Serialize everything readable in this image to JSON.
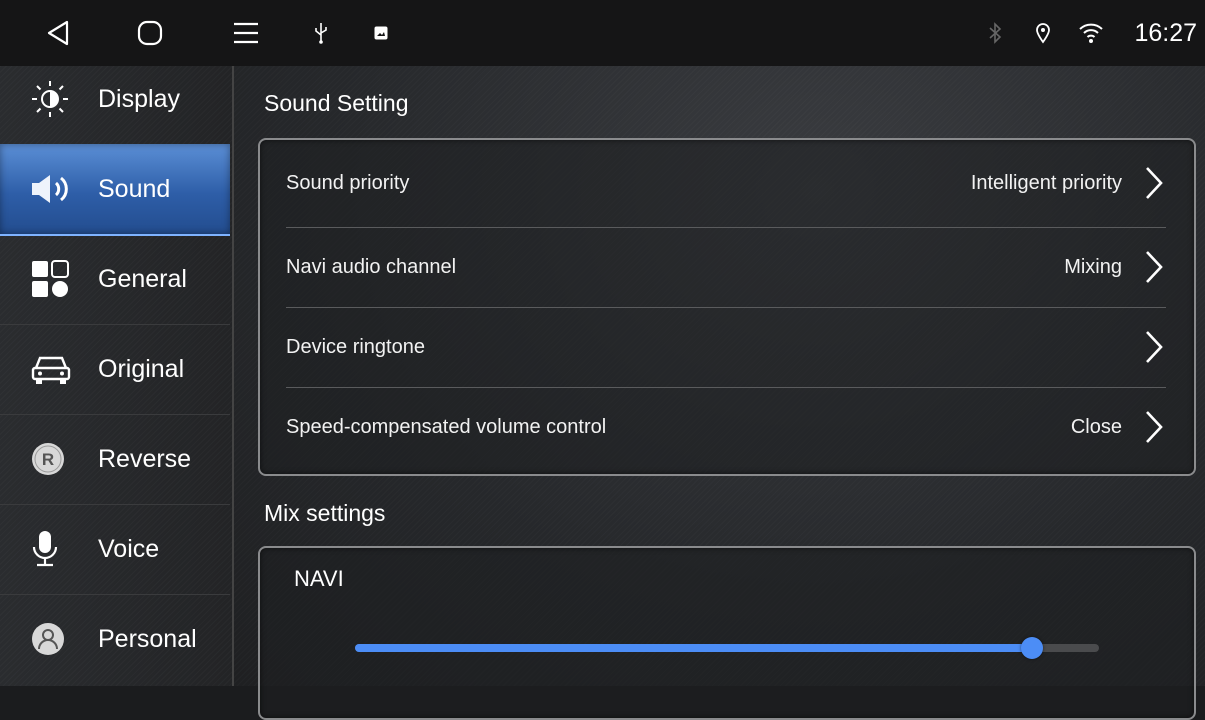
{
  "statusbar": {
    "time": "16:27",
    "icons": [
      "back-icon",
      "home-icon",
      "menu-icon",
      "usb-icon",
      "image-notification-icon",
      "bluetooth-icon",
      "location-icon",
      "wifi-icon"
    ]
  },
  "sidebar": {
    "items": [
      {
        "label": "Display",
        "icon": "brightness-icon"
      },
      {
        "label": "Sound",
        "icon": "speaker-icon",
        "active": true
      },
      {
        "label": "General",
        "icon": "grid-icon"
      },
      {
        "label": "Original",
        "icon": "car-icon"
      },
      {
        "label": "Reverse",
        "icon": "reverse-icon"
      },
      {
        "label": "Voice",
        "icon": "microphone-icon"
      },
      {
        "label": "Personal",
        "icon": "person-icon"
      }
    ]
  },
  "main": {
    "sound_setting": {
      "title": "Sound Setting",
      "rows": [
        {
          "label": "Sound priority",
          "value": "Intelligent priority"
        },
        {
          "label": "Navi audio channel",
          "value": "Mixing"
        },
        {
          "label": "Device ringtone",
          "value": ""
        },
        {
          "label": "Speed-compensated volume control",
          "value": "Close"
        }
      ]
    },
    "mix_settings": {
      "title": "Mix settings",
      "navi_label": "NAVI",
      "navi_level": 0.91
    }
  },
  "colors": {
    "accent": "#4c8df6",
    "active_tab": "#2e5ea8"
  }
}
